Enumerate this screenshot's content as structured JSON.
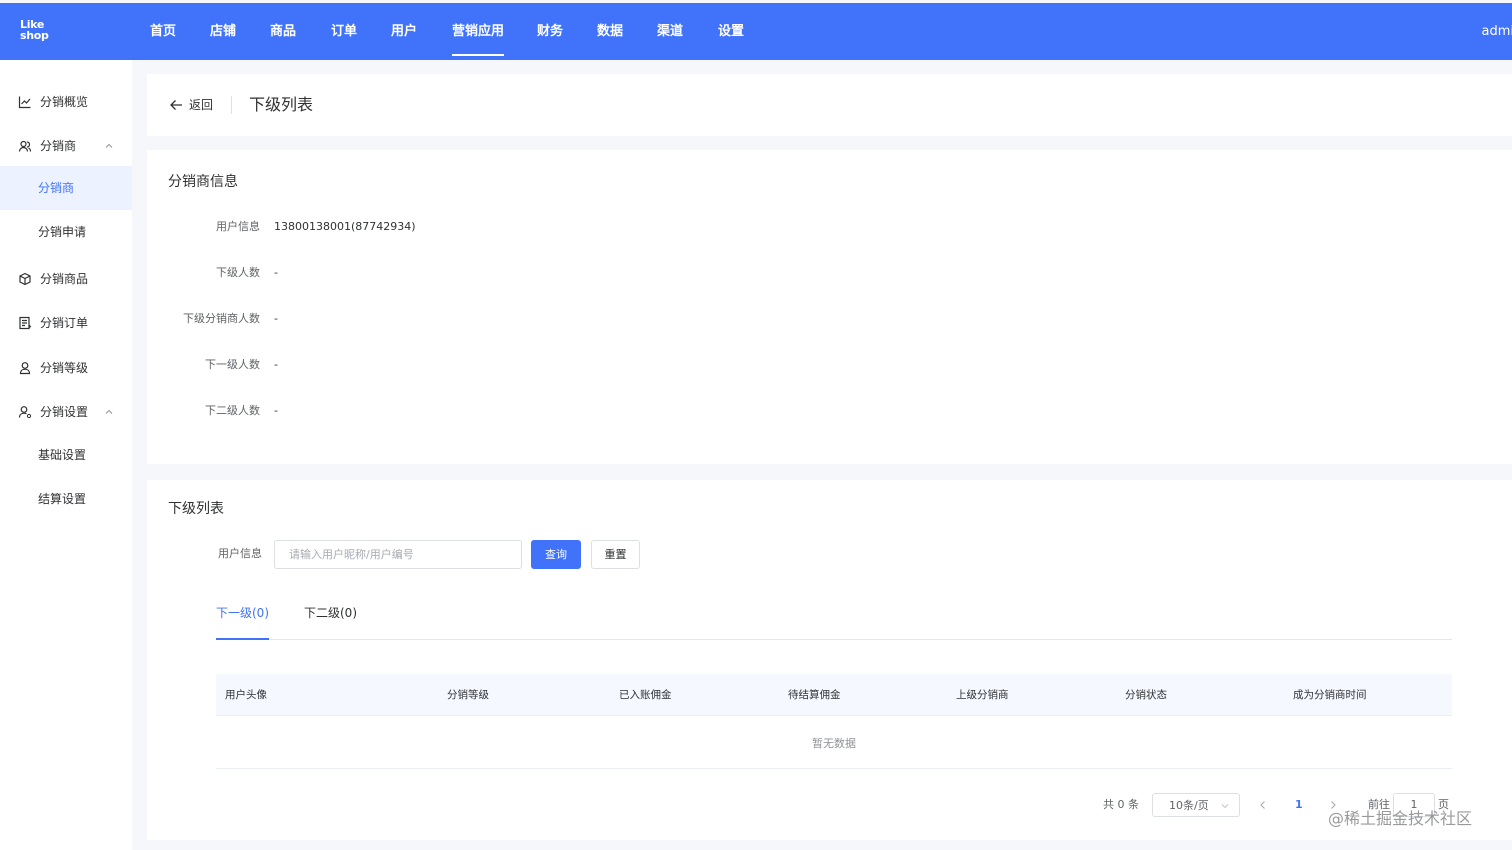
{
  "header": {
    "logo_line1": "Like",
    "logo_line2": "shop",
    "nav": [
      "首页",
      "店铺",
      "商品",
      "订单",
      "用户",
      "营销应用",
      "财务",
      "数据",
      "渠道",
      "设置"
    ],
    "active_nav": "营销应用",
    "user": "admi"
  },
  "sidebar": {
    "items": [
      {
        "label": "分销概览",
        "icon": "line-chart-icon"
      },
      {
        "label": "分销商",
        "icon": "users-icon",
        "expanded": true
      },
      {
        "label": "分销商",
        "sub": true,
        "active": true
      },
      {
        "label": "分销申请",
        "sub": true
      },
      {
        "label": "分销商品",
        "icon": "box-icon"
      },
      {
        "label": "分销订单",
        "icon": "order-icon"
      },
      {
        "label": "分销等级",
        "icon": "user-icon"
      },
      {
        "label": "分销设置",
        "icon": "user-settings-icon",
        "expanded": true
      },
      {
        "label": "基础设置",
        "sub": true
      },
      {
        "label": "结算设置",
        "sub": true
      }
    ]
  },
  "page_header": {
    "back_label": "返回",
    "title": "下级列表"
  },
  "distributor_info": {
    "title": "分销商信息",
    "rows": [
      {
        "label": "用户信息",
        "value": "13800138001(87742934)"
      },
      {
        "label": "下级人数",
        "value": "-"
      },
      {
        "label": "下级分销商人数",
        "value": "-"
      },
      {
        "label": "下一级人数",
        "value": "-"
      },
      {
        "label": "下二级人数",
        "value": "-"
      }
    ]
  },
  "sub_list": {
    "title": "下级列表",
    "filter_label": "用户信息",
    "search_placeholder": "请输入用户昵称/用户编号",
    "search_value": "",
    "query_button": "查询",
    "reset_button": "重置",
    "tabs": [
      "下一级(0)",
      "下二级(0)"
    ],
    "active_tab": 0,
    "columns": [
      "用户头像",
      "分销等级",
      "已入账佣金",
      "待结算佣金",
      "上级分销商",
      "分销状态",
      "成为分销商时间"
    ],
    "rows": [],
    "empty_text": "暂无数据"
  },
  "pagination": {
    "total_text": "共 0 条",
    "page_size": "10条/页",
    "current_page": "1",
    "goto_label": "前往",
    "goto_value": "1",
    "page_suffix": "页"
  },
  "watermark": "@稀土掘金技术社区",
  "colors": {
    "primary": "#4073fa",
    "active_bg": "#ecf2ff",
    "page_bg": "#f5f7fa"
  }
}
